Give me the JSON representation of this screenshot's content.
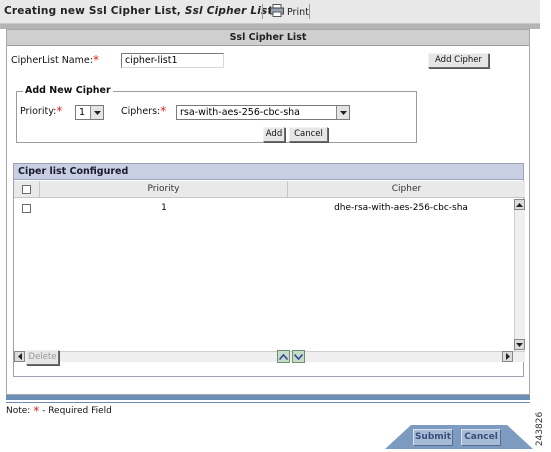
{
  "header": {
    "title_prefix": "Creating new Ssl Cipher List, ",
    "title_italic": "Ssl Cipher List",
    "print_label": "Print"
  },
  "panel": {
    "title": "Ssl Cipher List",
    "cipherlist_name_label": "CipherList Name:",
    "cipherlist_name_value": "cipher-list1",
    "add_cipher_button": "Add Cipher",
    "required_mark": "*"
  },
  "add_new_cipher": {
    "legend": "Add New Cipher",
    "priority_label": "Priority:",
    "priority_value": "1",
    "ciphers_label": "Ciphers:",
    "ciphers_value": "rsa-with-aes-256-cbc-sha",
    "add_button": "Add",
    "cancel_button": "Cancel"
  },
  "cipher_list": {
    "title": "Ciper list Configured",
    "columns": [
      "Priority",
      "Cipher"
    ],
    "rows": [
      {
        "priority": "1",
        "cipher": "dhe-rsa-with-aes-256-cbc-sha"
      }
    ],
    "delete_button": "Delete"
  },
  "note": {
    "prefix": "Note:",
    "mark": "*",
    "text": "- Required Field"
  },
  "footer": {
    "submit_button": "Submit",
    "cancel_button": "Cancel"
  },
  "figure_code": "243826",
  "colors": {
    "required": "#e0201e",
    "footer_bar": "#7d9ac0",
    "list_header": "#c8cfe3"
  }
}
